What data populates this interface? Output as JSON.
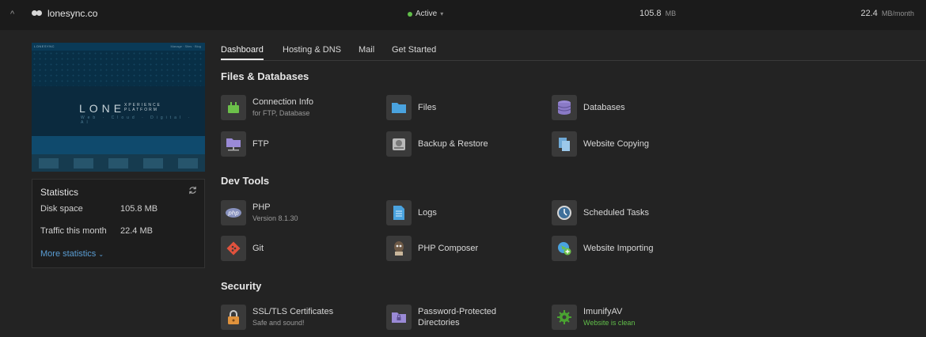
{
  "header": {
    "domain": "lonesync.co",
    "status": "Active",
    "disk_value": "105.8",
    "disk_unit": "MB",
    "traffic_value": "22.4",
    "traffic_unit": "MB/month"
  },
  "preview": {
    "logo": "LONESYNC",
    "nav": "Manage · Sites · Blog",
    "brand": "LONE",
    "xp_line1": "XPERIENCE",
    "xp_line2": "PLATFORM",
    "tagline": "Web · Cloud · Digital · AI"
  },
  "statistics": {
    "title": "Statistics",
    "disk_label": "Disk space",
    "disk_value": "105.8 MB",
    "traffic_label": "Traffic this month",
    "traffic_value": "22.4 MB",
    "more_label": "More statistics"
  },
  "tabs": [
    "Dashboard",
    "Hosting & DNS",
    "Mail",
    "Get Started"
  ],
  "sections": {
    "files": {
      "title": "Files & Databases",
      "items": [
        {
          "label": "Connection Info",
          "sub": "for FTP, Database",
          "icon": "plug-icon"
        },
        {
          "label": "Files",
          "icon": "folder-icon"
        },
        {
          "label": "Databases",
          "icon": "database-icon"
        },
        {
          "label": "FTP",
          "icon": "ftp-folder-icon"
        },
        {
          "label": "Backup & Restore",
          "icon": "backup-drive-icon"
        },
        {
          "label": "Website Copying",
          "icon": "copy-document-icon"
        }
      ]
    },
    "dev": {
      "title": "Dev Tools",
      "items": [
        {
          "label": "PHP",
          "sub": "Version 8.1.30",
          "icon": "php-icon"
        },
        {
          "label": "Logs",
          "icon": "log-file-icon"
        },
        {
          "label": "Scheduled Tasks",
          "icon": "clock-icon"
        },
        {
          "label": "Git",
          "icon": "git-icon"
        },
        {
          "label": "PHP Composer",
          "icon": "composer-icon"
        },
        {
          "label": "Website Importing",
          "icon": "globe-import-icon"
        }
      ]
    },
    "security": {
      "title": "Security",
      "items": [
        {
          "label": "SSL/TLS Certificates",
          "sub": "Safe and sound!",
          "icon": "lock-icon"
        },
        {
          "label": "Password-Protected",
          "label2": "Directories",
          "icon": "protected-folder-icon"
        },
        {
          "label": "ImunifyAV",
          "sub": "Website is clean",
          "icon": "shield-gear-icon"
        }
      ]
    }
  },
  "colors": {
    "accent_green": "#61bf4a",
    "link_blue": "#5a9dd3"
  }
}
